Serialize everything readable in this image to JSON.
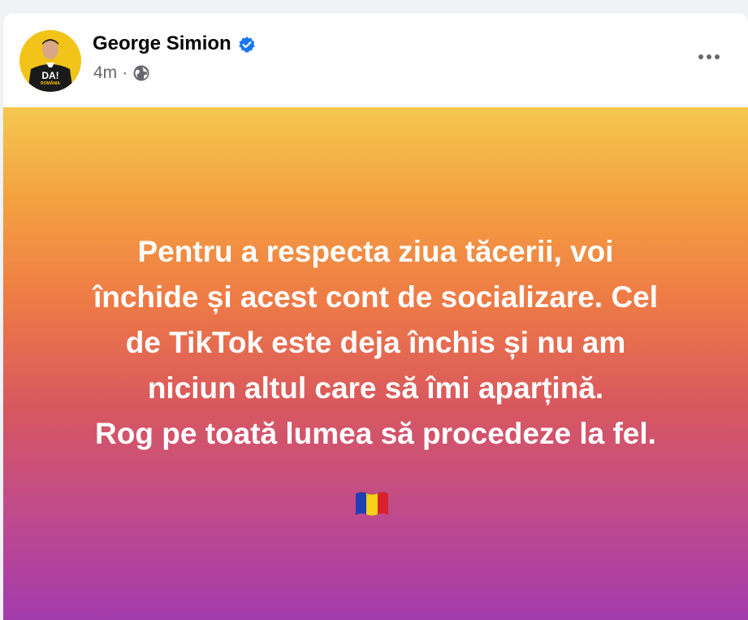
{
  "post": {
    "author": {
      "name": "George Simion",
      "verified": true,
      "avatar": {
        "description_icon": "profile-avatar",
        "badge_text": "DA!",
        "badge_subtext": "ROMÂNIA",
        "colors": {
          "background": "#f2c318",
          "suit": "#1a1a1a",
          "skin": "#d9a785"
        }
      }
    },
    "timestamp": "4m",
    "separator": "·",
    "privacy_icon": "globe-icon",
    "more_icon": "more-options-icon",
    "background_colors": [
      "#f5c74f",
      "#f4a140",
      "#ee7a46",
      "#d9585e",
      "#c14b8a",
      "#a33bad"
    ],
    "text_lines": [
      "Pentru a respecta ziua tăcerii, voi",
      "închide și acest cont de socializare. Cel",
      "de TikTok este deja închis și nu am",
      "niciun altul care să îmi aparțină.",
      "Rog pe toată lumea să procedeze la fel."
    ],
    "emoji": "romania-flag"
  }
}
